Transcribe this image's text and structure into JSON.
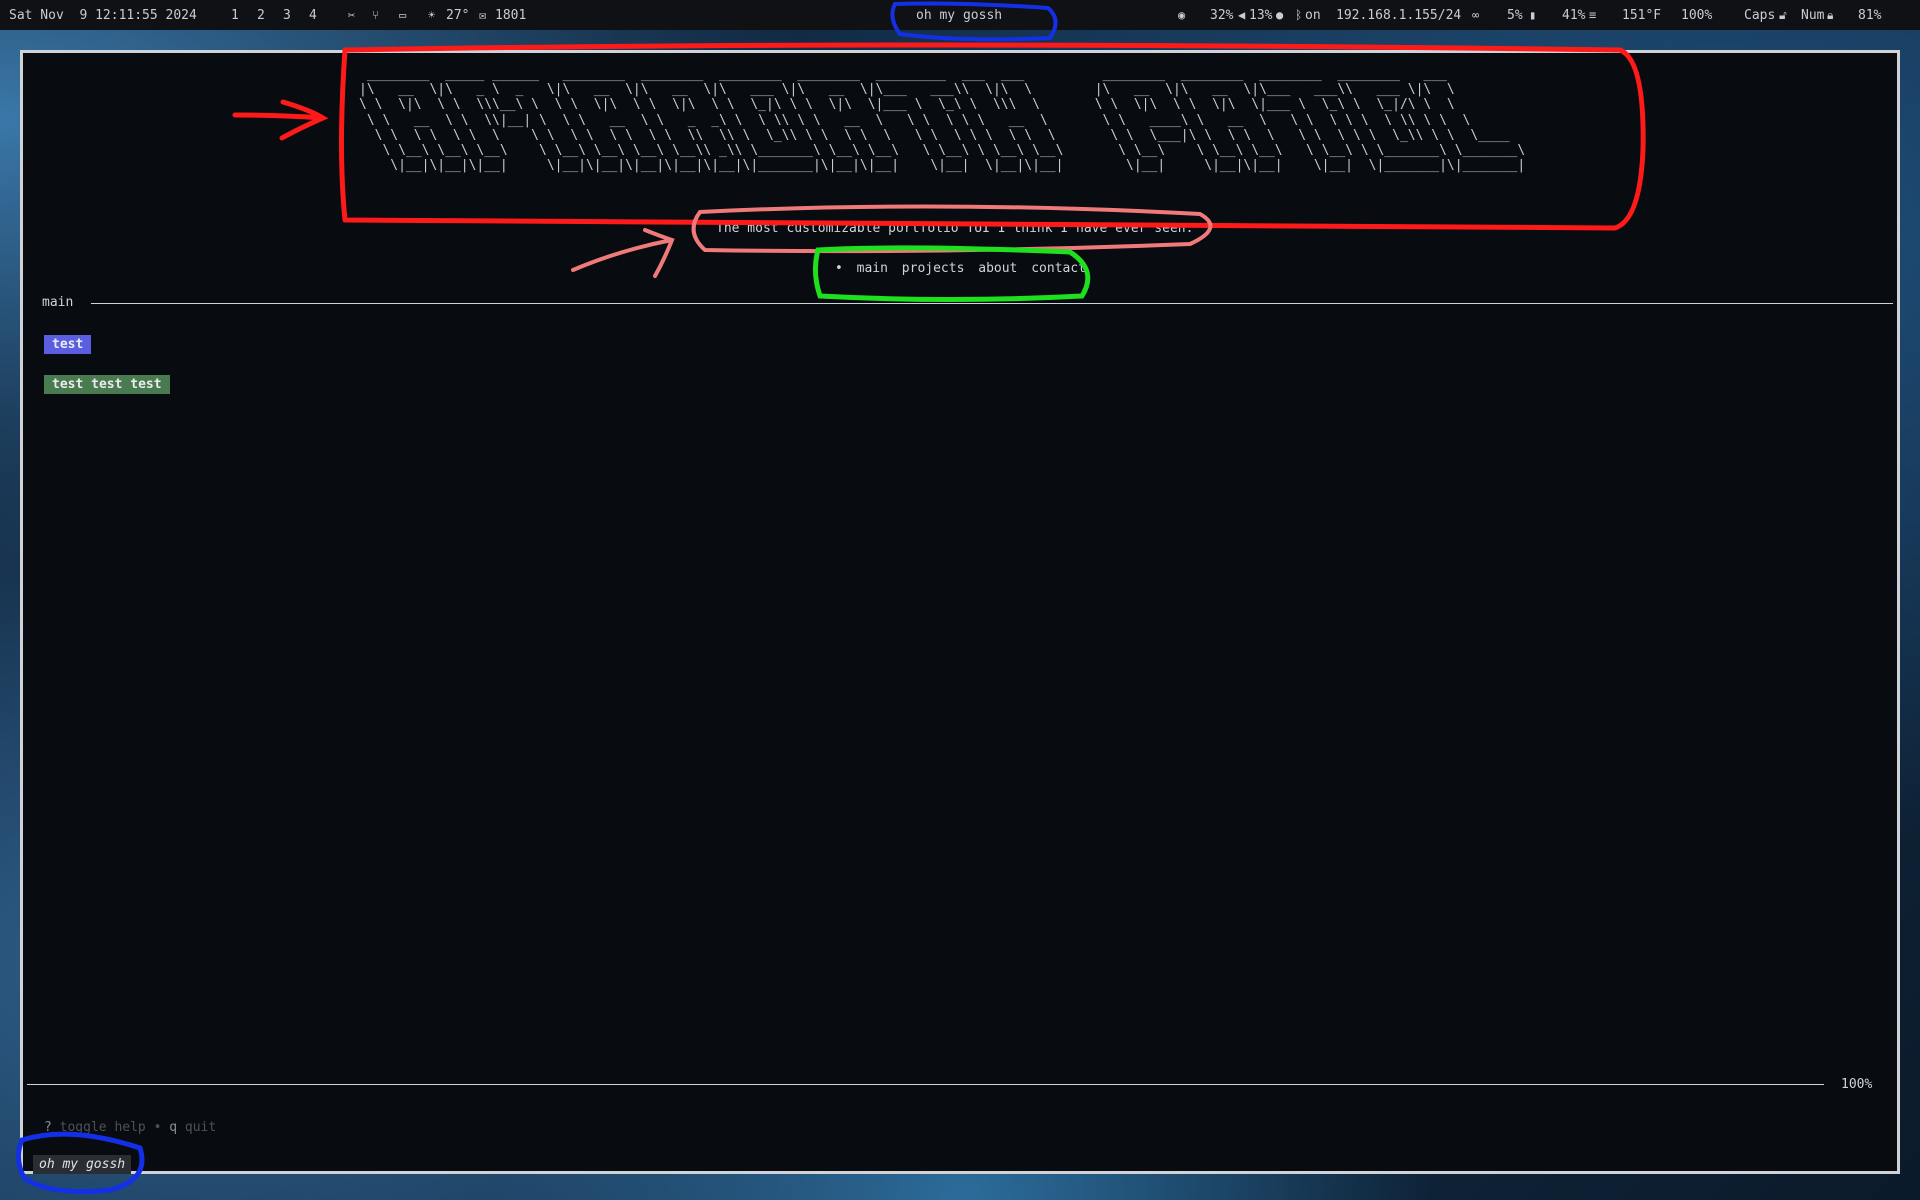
{
  "topbar": {
    "datetime": "Sat Nov  9 12:11:55 2024",
    "workspaces": [
      "1",
      "2",
      "3",
      "4"
    ],
    "weather_temp": "27°",
    "mail_count": "1801",
    "window_title": "oh my gossh",
    "volume": "32%",
    "mic": "13%",
    "bluetooth": "on",
    "ip": "192.168.1.155/24",
    "battery": "5%",
    "memory": "41%",
    "temperature": "151°F",
    "brightness": "100%",
    "caps": "Caps",
    "num": "Num",
    "battery2": "81%"
  },
  "app": {
    "ascii_banner": " ________  _____ ______   ________  ________  ________  ________  _________  ___  ___          ________  ________  ________  ________   ___\n|\\   __  \\|\\   _ \\  _   \\|\\   __  \\|\\   __  \\|\\   ___ \\|\\   __  \\|\\___   ___\\\\  \\|\\  \\        |\\   __  \\|\\   __  \\|\\___   ___\\\\   ___ \\|\\  \\\n\\ \\  \\|\\  \\ \\  \\\\\\__\\ \\  \\ \\  \\|\\  \\ \\  \\|\\  \\ \\  \\_|\\ \\ \\  \\|\\  \\|___ \\  \\_\\ \\  \\\\\\  \\       \\ \\  \\|\\  \\ \\  \\|\\  \\|___ \\  \\_\\ \\  \\_|/\\ \\  \\\n \\ \\   __  \\ \\  \\\\|__| \\  \\ \\   __  \\ \\   _  _\\ \\  \\ \\\\ \\ \\   __  \\   \\ \\  \\ \\ \\   __  \\       \\ \\   ____\\ \\   __  \\   \\ \\  \\ \\ \\  \\ \\\\ \\ \\  \\\n  \\ \\  \\ \\  \\ \\  \\    \\ \\  \\ \\  \\ \\  \\ \\  \\\\  \\\\ \\  \\_\\\\ \\ \\  \\ \\  \\   \\ \\  \\ \\ \\  \\ \\  \\       \\ \\  \\___|\\ \\  \\ \\  \\   \\ \\  \\ \\ \\  \\_\\\\ \\ \\  \\____\n   \\ \\__\\ \\__\\ \\__\\    \\ \\__\\ \\__\\ \\__\\ \\__\\\\ _\\\\ \\_______\\ \\__\\ \\__\\   \\ \\__\\ \\ \\__\\ \\__\\       \\ \\__\\    \\ \\__\\ \\__\\   \\ \\__\\ \\ \\_______\\ \\_______\\\n    \\|__|\\|__|\\|__|     \\|__|\\|__|\\|__|\\|__|\\|__|\\|_______|\\|__|\\|__|    \\|__|  \\|__|\\|__|        \\|__|     \\|__|\\|__|    \\|__|  \\|_______|\\|_______|",
    "tagline": "The most customizable portfolio TUI I think I have ever seen.",
    "nav": {
      "bullet": "•",
      "items": [
        "main",
        "projects",
        "about",
        "contact"
      ]
    },
    "section_title": "main",
    "tags": [
      "test",
      "test test test"
    ],
    "scroll_percent": "100%",
    "help": {
      "key1": "?",
      "label1": "toggle help",
      "sep": "•",
      "key2": "q",
      "label2": "quit"
    },
    "prompt": "oh my gossh"
  },
  "colors": {
    "tag_primary": "#5b5ee0",
    "tag_secondary": "#4a7a4f",
    "annotation_red": "#ff1a1a",
    "annotation_pink": "#f07a7a",
    "annotation_green": "#1ee01e",
    "annotation_blue": "#1430e6"
  }
}
